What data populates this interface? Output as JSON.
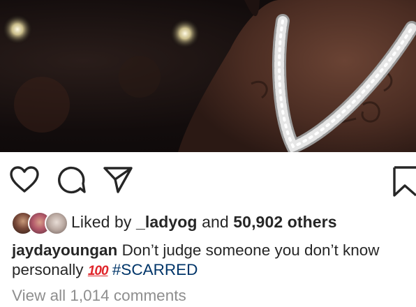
{
  "post": {
    "image_alt": "Photo of a person wearing a diamond chain necklace",
    "likes": {
      "prefix": "Liked by",
      "first_liker": "_ladyog",
      "conjunction": "and",
      "others": "50,902 others"
    },
    "caption": {
      "username": "jaydayoungan",
      "text": "Don’t judge someone you don’t know personally",
      "emoji": "100",
      "hashtag": "#SCARRED"
    },
    "view_comments": "View all 1,014 comments"
  },
  "icons": [
    "heart-icon",
    "comment-icon",
    "share-icon",
    "bookmark-icon"
  ],
  "colors": {
    "text": "#262626",
    "muted": "#8e8e8e",
    "hashtag": "#003569",
    "emoji": "#e0262b"
  }
}
